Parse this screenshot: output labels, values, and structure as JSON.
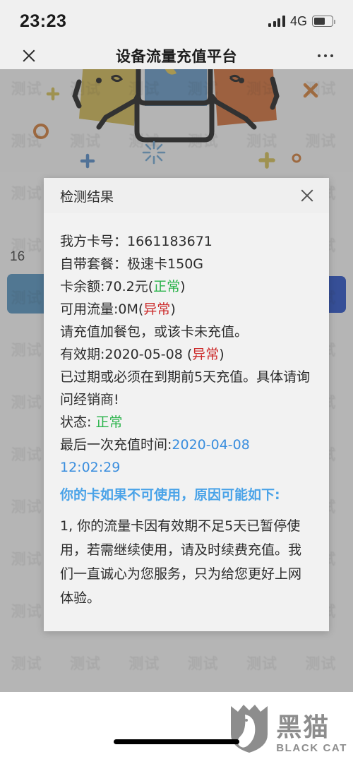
{
  "status_bar": {
    "time": "23:23",
    "network": "4G",
    "signal_icon": "signal-bars-icon",
    "battery_icon": "battery-icon"
  },
  "nav": {
    "close_icon": "close-icon",
    "title": "设备流量充值平台",
    "more_icon": "more-options-icon"
  },
  "banner": {
    "colors": {
      "yellow": "#d4b84a",
      "blue": "#5b94c7",
      "orange": "#d4672a",
      "outline": "#111111"
    },
    "deco": {
      "cross_orange": "#e08030",
      "circle_orange": "#d4762a",
      "plus_blue": "#4a86c8",
      "plus_yellow": "#d8c049",
      "gear_orange": "#d4762a",
      "star_blue": "#6aa6d8"
    }
  },
  "background_page": {
    "partial_number": "16",
    "left_button_color": "#4a8fc0",
    "right_button_color": "#1846c8"
  },
  "dialog": {
    "title": "检测结果",
    "close_icon": "close-icon",
    "rows": {
      "card_number_label": "我方卡号：",
      "card_number_value": "1661183671",
      "package_label": "自带套餐：",
      "package_value": "极速卡150G",
      "balance_text": "卡余额:70.2元(",
      "balance_status": "正常",
      "balance_text_end": ")",
      "data_text": "可用流量:0M(",
      "data_status": "异常",
      "data_text_end": ")",
      "data_note": "请充值加餐包，或该卡未充值。",
      "expiry_text": "有效期:2020-05-08 (",
      "expiry_status": "异常",
      "expiry_text_end": ")",
      "expiry_note": "已过期或必须在到期前5天充值。具体请询问经销商!",
      "state_label": "状态: ",
      "state_value": "正常",
      "last_recharge_label": "最后一次充值时间:",
      "last_recharge_value": "2020-04-08 12:02:29"
    },
    "hint_heading": "你的卡如果不可使用，原因可能如下:",
    "hint_paragraph": "1, 你的流量卡因有效期不足5天已暂停使用，若需继续使用，请及时续费充值。我们一直诚心为您服务，只为给您更好上网体验。",
    "status_colors": {
      "normal": "#2ab34a",
      "abnormal": "#cc2b2b",
      "timestamp": "#3a8ede",
      "hint": "#4aa3e8"
    }
  },
  "watermark": {
    "text": "测试",
    "count": 84
  },
  "brand": {
    "cn": "黑猫",
    "en": "BLACK CAT",
    "shield_icon": "cat-shield-logo-icon"
  },
  "home_indicator": "home-indicator"
}
